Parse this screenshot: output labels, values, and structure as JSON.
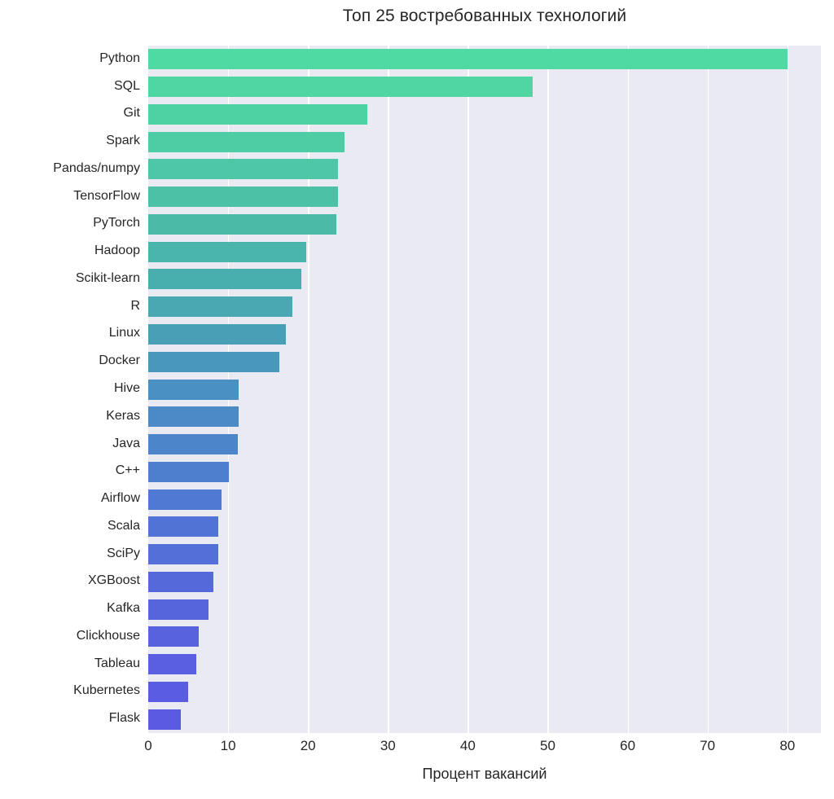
{
  "chart_data": {
    "type": "bar",
    "orientation": "horizontal",
    "title": "Топ 25 востребованных технологий",
    "xlabel": "Процент вакансий",
    "ylabel": "",
    "xlim": [
      0,
      84.2
    ],
    "ylim": [
      0,
      25
    ],
    "grid": true,
    "legend": null,
    "xticks": [
      0,
      10,
      20,
      30,
      40,
      50,
      60,
      70,
      80
    ],
    "xticklabels": [
      "0",
      "10",
      "20",
      "30",
      "40",
      "50",
      "60",
      "70",
      "80"
    ],
    "categories": [
      "Python",
      "SQL",
      "Git",
      "Spark",
      "Pandas/numpy",
      "TensorFlow",
      "PyTorch",
      "Hadoop",
      "Scikit-learn",
      "R",
      "Linux",
      "Docker",
      "Hive",
      "Keras",
      "Java",
      "C++",
      "Airflow",
      "Scala",
      "SciPy",
      "XGBoost",
      "Kafka",
      "Clickhouse",
      "Tableau",
      "Kubernetes",
      "Flask"
    ],
    "values": [
      80.0,
      48.1,
      27.4,
      24.6,
      23.8,
      23.8,
      23.5,
      19.8,
      19.2,
      18.0,
      17.2,
      16.4,
      11.3,
      11.3,
      11.2,
      10.1,
      9.2,
      8.8,
      8.8,
      8.2,
      7.5,
      6.3,
      6.0,
      5.0,
      4.1
    ],
    "colors": [
      "#4fd9a3",
      "#4fd6a2",
      "#4ed2a3",
      "#4ecda4",
      "#4dc7a5",
      "#4cc1a6",
      "#4bbba8",
      "#4ab5ab",
      "#49aeae",
      "#49a8b2",
      "#489fb6",
      "#4a97bd",
      "#4b90c2",
      "#4c8ac6",
      "#4d85ca",
      "#4e7fce",
      "#4f79d2",
      "#5173d5",
      "#5370d8",
      "#5569da",
      "#5765dd",
      "#5862de",
      "#595fe0",
      "#5a5de1",
      "#5b5ae2"
    ],
    "style": {
      "plot_background": "#eaeaf2",
      "figure_background": "#ffffff",
      "gridline_color": "#ffffff",
      "text_color": "#262626"
    }
  }
}
